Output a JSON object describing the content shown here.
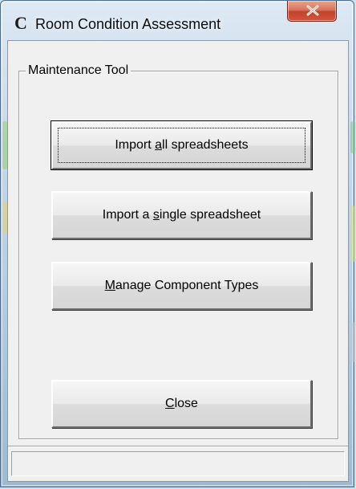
{
  "window": {
    "title": "Room Condition Assessment",
    "icon_glyph": "C",
    "icon_name": "app-c-icon",
    "close_icon": "close-x-icon"
  },
  "group": {
    "label": "Maintenance Tool"
  },
  "buttons": {
    "import_all": {
      "before": "Import ",
      "accel": "a",
      "after": "ll spreadsheets"
    },
    "import_single": {
      "before": "Import a ",
      "accel": "s",
      "after": "ingle spreadsheet"
    },
    "manage_types": {
      "before": "",
      "accel": "M",
      "after": "anage Component Types"
    },
    "close": {
      "before": "",
      "accel": "C",
      "after": "lose"
    }
  },
  "status_bar": {
    "text": ""
  },
  "colors": {
    "close_button": "#c3412a",
    "client_background": "#f0f0f0",
    "frame": "#b5cde0"
  }
}
